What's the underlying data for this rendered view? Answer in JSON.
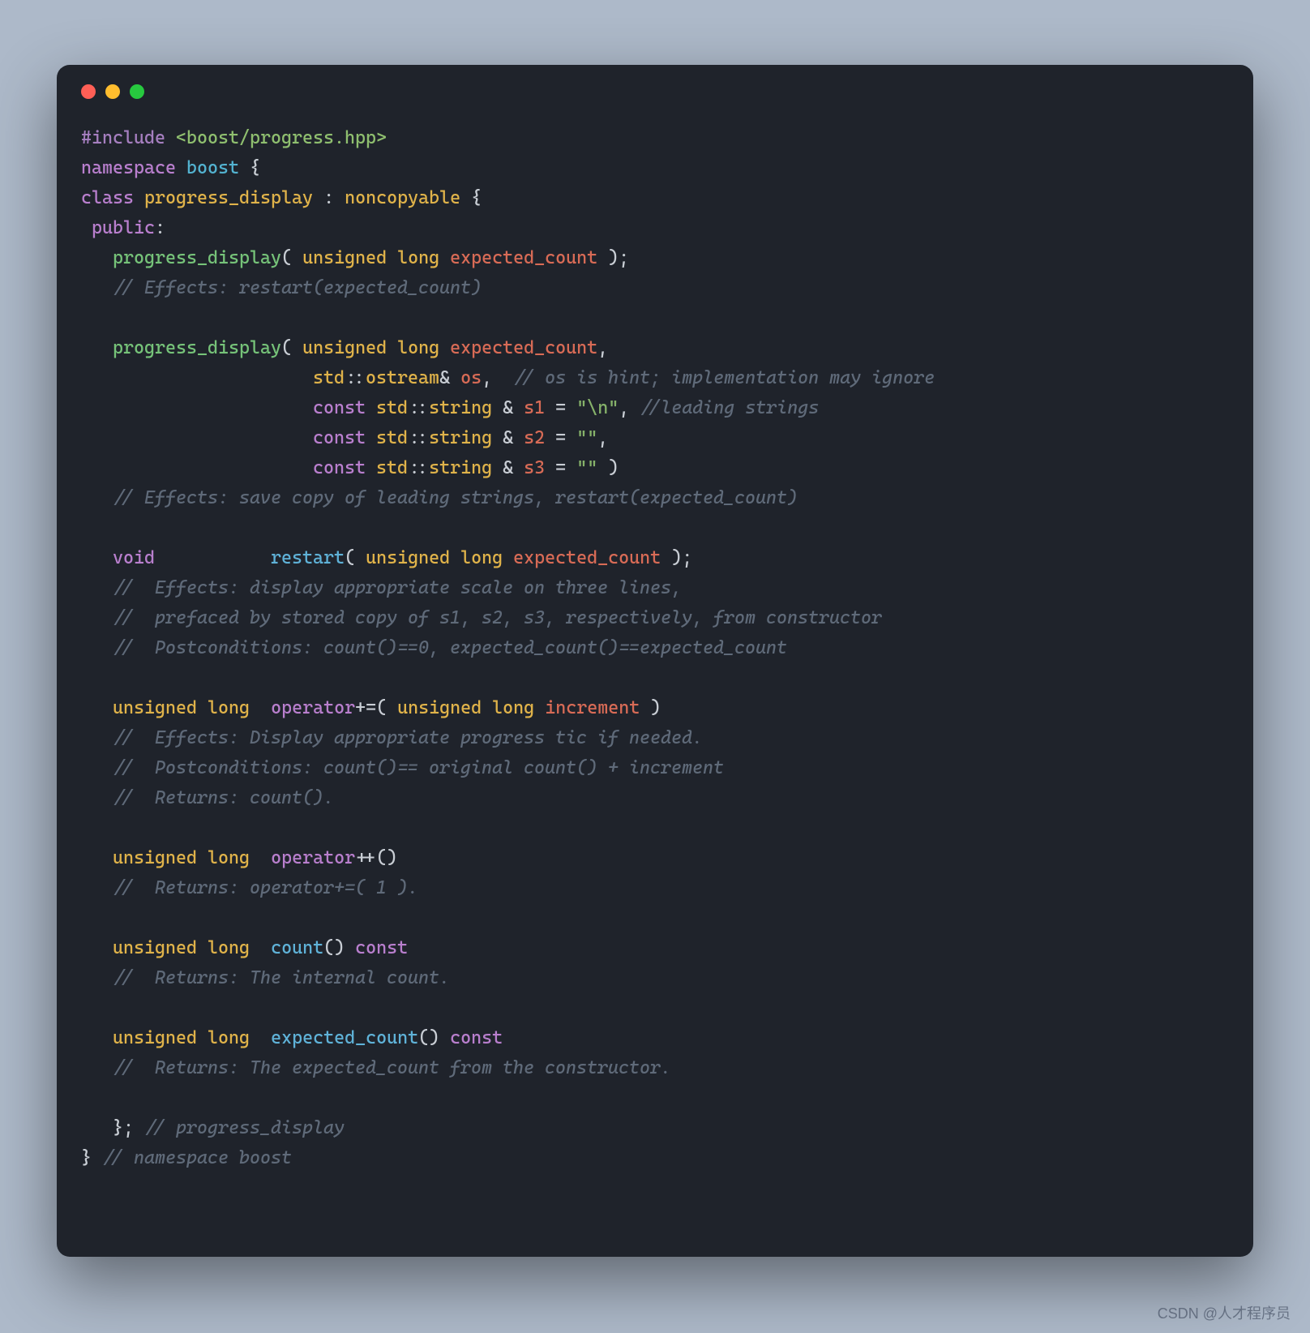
{
  "watermark": "CSDN @人才程序员",
  "code": {
    "tokens": [
      {
        "c": "c-pre",
        "t": "#include"
      },
      {
        "c": "c-pun",
        "t": " "
      },
      {
        "c": "c-inc",
        "t": "<boost/progress.hpp>"
      },
      {
        "nl": 1
      },
      {
        "c": "c-kw",
        "t": "namespace"
      },
      {
        "c": "c-pun",
        "t": " "
      },
      {
        "c": "c-ns",
        "t": "boost"
      },
      {
        "c": "c-pun",
        "t": " "
      },
      {
        "c": "c-white",
        "t": "{"
      },
      {
        "nl": 1
      },
      {
        "c": "c-kw",
        "t": "class"
      },
      {
        "c": "c-pun",
        "t": " "
      },
      {
        "c": "c-type",
        "t": "progress_display"
      },
      {
        "c": "c-pun",
        "t": " "
      },
      {
        "c": "c-white",
        "t": ":"
      },
      {
        "c": "c-pun",
        "t": " "
      },
      {
        "c": "c-type",
        "t": "noncopyable"
      },
      {
        "c": "c-pun",
        "t": " "
      },
      {
        "c": "c-white",
        "t": "{"
      },
      {
        "nl": 1
      },
      {
        "c": "c-pun",
        "t": " "
      },
      {
        "c": "c-kw",
        "t": "public"
      },
      {
        "c": "c-white",
        "t": ":"
      },
      {
        "nl": 1
      },
      {
        "c": "c-pun",
        "t": "   "
      },
      {
        "c": "c-fn2",
        "t": "progress_display"
      },
      {
        "c": "c-white",
        "t": "("
      },
      {
        "c": "c-pun",
        "t": " "
      },
      {
        "c": "c-type",
        "t": "unsigned"
      },
      {
        "c": "c-pun",
        "t": " "
      },
      {
        "c": "c-type",
        "t": "long"
      },
      {
        "c": "c-pun",
        "t": " "
      },
      {
        "c": "c-id",
        "t": "expected_count"
      },
      {
        "c": "c-pun",
        "t": " "
      },
      {
        "c": "c-white",
        "t": ");"
      },
      {
        "nl": 1
      },
      {
        "c": "c-pun",
        "t": "   "
      },
      {
        "c": "c-cmt",
        "t": "// Effects: restart(expected_count)"
      },
      {
        "nl": 1
      },
      {
        "nl": 1
      },
      {
        "c": "c-pun",
        "t": "   "
      },
      {
        "c": "c-fn2",
        "t": "progress_display"
      },
      {
        "c": "c-white",
        "t": "("
      },
      {
        "c": "c-pun",
        "t": " "
      },
      {
        "c": "c-type",
        "t": "unsigned"
      },
      {
        "c": "c-pun",
        "t": " "
      },
      {
        "c": "c-type",
        "t": "long"
      },
      {
        "c": "c-pun",
        "t": " "
      },
      {
        "c": "c-id",
        "t": "expected_count"
      },
      {
        "c": "c-white",
        "t": ","
      },
      {
        "nl": 1
      },
      {
        "c": "c-pun",
        "t": "                      "
      },
      {
        "c": "c-type",
        "t": "std"
      },
      {
        "c": "c-white",
        "t": "::"
      },
      {
        "c": "c-type",
        "t": "ostream"
      },
      {
        "c": "c-white",
        "t": "& "
      },
      {
        "c": "c-id",
        "t": "os"
      },
      {
        "c": "c-white",
        "t": ","
      },
      {
        "c": "c-pun",
        "t": "  "
      },
      {
        "c": "c-cmt",
        "t": "// os is hint; implementation may ignore"
      },
      {
        "nl": 1
      },
      {
        "c": "c-pun",
        "t": "                      "
      },
      {
        "c": "c-kw",
        "t": "const"
      },
      {
        "c": "c-pun",
        "t": " "
      },
      {
        "c": "c-type",
        "t": "std"
      },
      {
        "c": "c-white",
        "t": "::"
      },
      {
        "c": "c-type",
        "t": "string"
      },
      {
        "c": "c-pun",
        "t": " "
      },
      {
        "c": "c-white",
        "t": "&"
      },
      {
        "c": "c-pun",
        "t": " "
      },
      {
        "c": "c-id",
        "t": "s1"
      },
      {
        "c": "c-pun",
        "t": " "
      },
      {
        "c": "c-white",
        "t": "="
      },
      {
        "c": "c-pun",
        "t": " "
      },
      {
        "c": "c-str",
        "t": "\"\\n\""
      },
      {
        "c": "c-white",
        "t": ","
      },
      {
        "c": "c-pun",
        "t": " "
      },
      {
        "c": "c-cmt",
        "t": "//leading strings"
      },
      {
        "nl": 1
      },
      {
        "c": "c-pun",
        "t": "                      "
      },
      {
        "c": "c-kw",
        "t": "const"
      },
      {
        "c": "c-pun",
        "t": " "
      },
      {
        "c": "c-type",
        "t": "std"
      },
      {
        "c": "c-white",
        "t": "::"
      },
      {
        "c": "c-type",
        "t": "string"
      },
      {
        "c": "c-pun",
        "t": " "
      },
      {
        "c": "c-white",
        "t": "&"
      },
      {
        "c": "c-pun",
        "t": " "
      },
      {
        "c": "c-id",
        "t": "s2"
      },
      {
        "c": "c-pun",
        "t": " "
      },
      {
        "c": "c-white",
        "t": "="
      },
      {
        "c": "c-pun",
        "t": " "
      },
      {
        "c": "c-str",
        "t": "\"\""
      },
      {
        "c": "c-white",
        "t": ","
      },
      {
        "nl": 1
      },
      {
        "c": "c-pun",
        "t": "                      "
      },
      {
        "c": "c-kw",
        "t": "const"
      },
      {
        "c": "c-pun",
        "t": " "
      },
      {
        "c": "c-type",
        "t": "std"
      },
      {
        "c": "c-white",
        "t": "::"
      },
      {
        "c": "c-type",
        "t": "string"
      },
      {
        "c": "c-pun",
        "t": " "
      },
      {
        "c": "c-white",
        "t": "&"
      },
      {
        "c": "c-pun",
        "t": " "
      },
      {
        "c": "c-id",
        "t": "s3"
      },
      {
        "c": "c-pun",
        "t": " "
      },
      {
        "c": "c-white",
        "t": "="
      },
      {
        "c": "c-pun",
        "t": " "
      },
      {
        "c": "c-str",
        "t": "\"\""
      },
      {
        "c": "c-pun",
        "t": " "
      },
      {
        "c": "c-white",
        "t": ")"
      },
      {
        "nl": 1
      },
      {
        "c": "c-pun",
        "t": "   "
      },
      {
        "c": "c-cmt",
        "t": "// Effects: save copy of leading strings, restart(expected_count)"
      },
      {
        "nl": 1
      },
      {
        "nl": 1
      },
      {
        "c": "c-pun",
        "t": "   "
      },
      {
        "c": "c-kw",
        "t": "void"
      },
      {
        "c": "c-pun",
        "t": "           "
      },
      {
        "c": "c-fn",
        "t": "restart"
      },
      {
        "c": "c-white",
        "t": "("
      },
      {
        "c": "c-pun",
        "t": " "
      },
      {
        "c": "c-type",
        "t": "unsigned"
      },
      {
        "c": "c-pun",
        "t": " "
      },
      {
        "c": "c-type",
        "t": "long"
      },
      {
        "c": "c-pun",
        "t": " "
      },
      {
        "c": "c-id",
        "t": "expected_count"
      },
      {
        "c": "c-pun",
        "t": " "
      },
      {
        "c": "c-white",
        "t": ");"
      },
      {
        "nl": 1
      },
      {
        "c": "c-pun",
        "t": "   "
      },
      {
        "c": "c-cmt",
        "t": "//  Effects: display appropriate scale on three lines,"
      },
      {
        "nl": 1
      },
      {
        "c": "c-pun",
        "t": "   "
      },
      {
        "c": "c-cmt",
        "t": "//  prefaced by stored copy of s1, s2, s3, respectively, from constructor"
      },
      {
        "nl": 1
      },
      {
        "c": "c-pun",
        "t": "   "
      },
      {
        "c": "c-cmt",
        "t": "//  Postconditions: count()==0, expected_count()==expected_count"
      },
      {
        "nl": 1
      },
      {
        "nl": 1
      },
      {
        "c": "c-pun",
        "t": "   "
      },
      {
        "c": "c-type",
        "t": "unsigned"
      },
      {
        "c": "c-pun",
        "t": " "
      },
      {
        "c": "c-type",
        "t": "long"
      },
      {
        "c": "c-pun",
        "t": "  "
      },
      {
        "c": "c-kw",
        "t": "operator"
      },
      {
        "c": "c-white",
        "t": "+=("
      },
      {
        "c": "c-pun",
        "t": " "
      },
      {
        "c": "c-type",
        "t": "unsigned"
      },
      {
        "c": "c-pun",
        "t": " "
      },
      {
        "c": "c-type",
        "t": "long"
      },
      {
        "c": "c-pun",
        "t": " "
      },
      {
        "c": "c-id",
        "t": "increment"
      },
      {
        "c": "c-pun",
        "t": " "
      },
      {
        "c": "c-white",
        "t": ")"
      },
      {
        "nl": 1
      },
      {
        "c": "c-pun",
        "t": "   "
      },
      {
        "c": "c-cmt",
        "t": "//  Effects: Display appropriate progress tic if needed."
      },
      {
        "nl": 1
      },
      {
        "c": "c-pun",
        "t": "   "
      },
      {
        "c": "c-cmt",
        "t": "//  Postconditions: count()== original count() + increment"
      },
      {
        "nl": 1
      },
      {
        "c": "c-pun",
        "t": "   "
      },
      {
        "c": "c-cmt",
        "t": "//  Returns: count()."
      },
      {
        "nl": 1
      },
      {
        "nl": 1
      },
      {
        "c": "c-pun",
        "t": "   "
      },
      {
        "c": "c-type",
        "t": "unsigned"
      },
      {
        "c": "c-pun",
        "t": " "
      },
      {
        "c": "c-type",
        "t": "long"
      },
      {
        "c": "c-pun",
        "t": "  "
      },
      {
        "c": "c-kw",
        "t": "operator"
      },
      {
        "c": "c-white",
        "t": "++()"
      },
      {
        "nl": 1
      },
      {
        "c": "c-pun",
        "t": "   "
      },
      {
        "c": "c-cmt",
        "t": "//  Returns: operator+=( 1 )."
      },
      {
        "nl": 1
      },
      {
        "nl": 1
      },
      {
        "c": "c-pun",
        "t": "   "
      },
      {
        "c": "c-type",
        "t": "unsigned"
      },
      {
        "c": "c-pun",
        "t": " "
      },
      {
        "c": "c-type",
        "t": "long"
      },
      {
        "c": "c-pun",
        "t": "  "
      },
      {
        "c": "c-fn",
        "t": "count"
      },
      {
        "c": "c-white",
        "t": "()"
      },
      {
        "c": "c-pun",
        "t": " "
      },
      {
        "c": "c-kw",
        "t": "const"
      },
      {
        "nl": 1
      },
      {
        "c": "c-pun",
        "t": "   "
      },
      {
        "c": "c-cmt",
        "t": "//  Returns: The internal count."
      },
      {
        "nl": 1
      },
      {
        "nl": 1
      },
      {
        "c": "c-pun",
        "t": "   "
      },
      {
        "c": "c-type",
        "t": "unsigned"
      },
      {
        "c": "c-pun",
        "t": " "
      },
      {
        "c": "c-type",
        "t": "long"
      },
      {
        "c": "c-pun",
        "t": "  "
      },
      {
        "c": "c-fn",
        "t": "expected_count"
      },
      {
        "c": "c-white",
        "t": "()"
      },
      {
        "c": "c-pun",
        "t": " "
      },
      {
        "c": "c-kw",
        "t": "const"
      },
      {
        "nl": 1
      },
      {
        "c": "c-pun",
        "t": "   "
      },
      {
        "c": "c-cmt",
        "t": "//  Returns: The expected_count from the constructor."
      },
      {
        "nl": 1
      },
      {
        "nl": 1
      },
      {
        "c": "c-pun",
        "t": "   "
      },
      {
        "c": "c-white",
        "t": "};"
      },
      {
        "c": "c-pun",
        "t": " "
      },
      {
        "c": "c-cmt",
        "t": "// progress_display"
      },
      {
        "nl": 1
      },
      {
        "c": "c-white",
        "t": "}"
      },
      {
        "c": "c-pun",
        "t": " "
      },
      {
        "c": "c-cmt",
        "t": "// namespace boost"
      }
    ]
  }
}
